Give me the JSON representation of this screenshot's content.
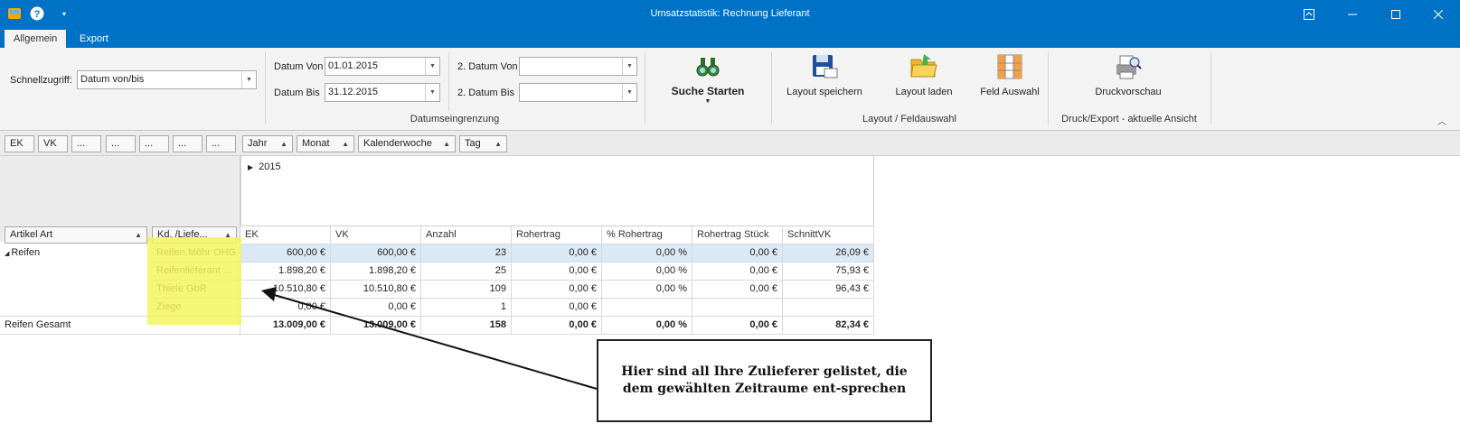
{
  "window": {
    "title": "Umsatzstatistik: Rechnung Lieferant"
  },
  "tabs": [
    {
      "label": "Allgemein"
    },
    {
      "label": "Export"
    }
  ],
  "ribbon": {
    "schnellzugriff_label": "Schnellzugriff:",
    "schnellzugriff_value": "Datum von/bis",
    "datum_von_label": "Datum Von",
    "datum_von_value": "01.01.2015",
    "datum_bis_label": "Datum Bis",
    "datum_bis_value": "31.12.2015",
    "datum2_von_label": "2. Datum Von",
    "datum2_von_value": "",
    "datum2_bis_label": "2. Datum Bis",
    "datum2_bis_value": "",
    "group_datum": "Datumseingrenzung",
    "suche_starten": "Suche Starten",
    "layout_speichern": "Layout speichern",
    "layout_laden": "Layout laden",
    "feld_auswahl": "Feld Auswahl",
    "group_layout": "Layout / Feldauswahl",
    "druckvorschau": "Druckvorschau",
    "group_druck": "Druck/Export - aktuelle Ansicht"
  },
  "pivot": {
    "data_fields": [
      "EK",
      "VK",
      "...",
      "...",
      "...",
      "...",
      "..."
    ],
    "column_fields": [
      "Jahr",
      "Monat",
      "Kalenderwoche",
      "Tag"
    ],
    "row_fields": [
      "Artikel Art",
      "Kd. /Liefe..."
    ],
    "year": "2015",
    "measures": [
      "EK",
      "VK",
      "Anzahl",
      "Rohertrag",
      "% Rohertrag",
      "Rohertrag Stück",
      "SchnittVK"
    ],
    "group_label": "Reifen",
    "rows": [
      {
        "name": "Reifen Möhr OHG",
        "cells": [
          "600,00 €",
          "600,00 €",
          "23",
          "0,00 €",
          "0,00 %",
          "0,00 €",
          "26,09 €"
        ]
      },
      {
        "name": "Reifenlieferant ...",
        "cells": [
          "1.898,20 €",
          "1.898,20 €",
          "25",
          "0,00 €",
          "0,00 %",
          "0,00 €",
          "75,93 €"
        ]
      },
      {
        "name": "Thiele GbR",
        "cells": [
          "10.510,80 €",
          "10.510,80 €",
          "109",
          "0,00 €",
          "0,00 %",
          "0,00 €",
          "96,43 €"
        ]
      },
      {
        "name": "Ziege",
        "cells": [
          "0,00 €",
          "0,00 €",
          "1",
          "0,00 €",
          "",
          "",
          ""
        ]
      }
    ],
    "total_label": "Reifen Gesamt",
    "total_cells": [
      "13.009,00 €",
      "13.009,00 €",
      "158",
      "0,00 €",
      "0,00 %",
      "0,00 €",
      "82,34 €"
    ]
  },
  "callout": {
    "text": "Hier sind all Ihre Zulieferer gelistet, die dem gewählten Zeitraume ent-sprechen"
  },
  "colors": {
    "accent": "#0072c6",
    "highlight": "#f4f45e"
  }
}
